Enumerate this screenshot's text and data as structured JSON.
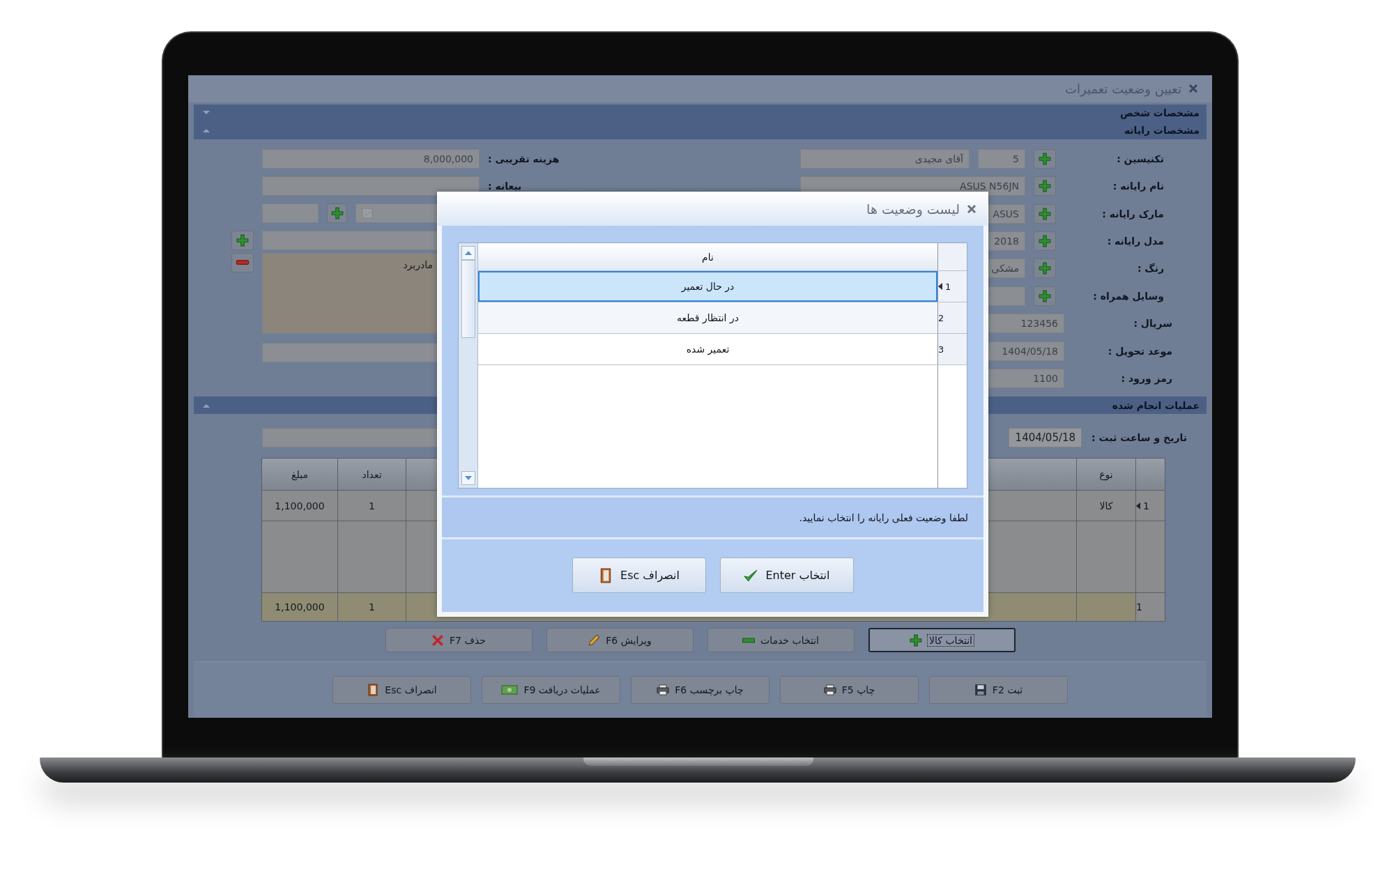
{
  "window": {
    "title": "تعیین وضعیت تعمیرات"
  },
  "sections": [
    {
      "title": "مشخصات شخص",
      "expanded": false
    },
    {
      "title": "مشخصات رایانه",
      "expanded": true
    }
  ],
  "left_fields": [
    {
      "kind": "text",
      "label": "هزینه تقریبی :",
      "value": "8,000,000"
    },
    {
      "kind": "text",
      "label": "بیعانه :"
    },
    {
      "kind": "combo-row"
    },
    {
      "kind": "add-row"
    },
    {
      "kind": "notes",
      "value": "مادربرد"
    },
    {
      "kind": "text"
    }
  ],
  "right_fields": [
    {
      "kind": "text",
      "label": "تکنیسین :",
      "code": "5",
      "value": "آقای مجیدی",
      "add_button": true
    },
    {
      "kind": "text",
      "label": "نام رایانه :",
      "value": "ASUS N56JN",
      "add_button": true
    },
    {
      "kind": "text",
      "label": "مارک رایانه :",
      "value": "ASUS",
      "add_button": true
    },
    {
      "kind": "text",
      "label": "مدل رایانه :",
      "value": "2018",
      "add_button": true
    },
    {
      "kind": "text",
      "label": "رنگ :",
      "value": "مشکی",
      "add_button": true
    },
    {
      "kind": "dropdown",
      "label": "وسایل همراه :",
      "add_button": true
    },
    {
      "kind": "text",
      "label": "سریال :",
      "value": "123456",
      "add_button": false
    },
    {
      "kind": "text",
      "label": "موعد تحویل :",
      "value": "1404/05/18",
      "add_button": false
    },
    {
      "kind": "text",
      "label": "رمز ورود :",
      "value": "1100",
      "add_button": false
    }
  ],
  "operations": {
    "title": "عملیات انجام شده",
    "expanded": true,
    "date_label": "تاریخ و ساعت ثبت :",
    "date_value": "1404/05/18"
  },
  "grid": {
    "columns": [
      "نوع",
      "تعداد",
      "مبلغ"
    ],
    "rows": [
      {
        "index": "1",
        "type": "کالا",
        "count": "1",
        "amount": "1,100,000",
        "selected": true
      }
    ],
    "footer": {
      "index": "1",
      "count": "1",
      "amount": "1,100,000"
    }
  },
  "item_buttons": [
    {
      "label": "انتخاب کالا",
      "focused": true
    },
    {
      "label": "انتخاب خدمات",
      "focused": false
    },
    {
      "label": "ویرایش F6",
      "focused": false
    },
    {
      "label": "حذف F7",
      "focused": false
    }
  ],
  "footer_buttons": [
    {
      "label": "ثبت F2"
    },
    {
      "label": "چاپ F5"
    },
    {
      "label": "چاپ برچسب F6"
    },
    {
      "label": "عملیات دریافت F9"
    },
    {
      "label": "انصراف Esc"
    }
  ],
  "dialog": {
    "title": "لیست وضعیت ها",
    "column": "نام",
    "items": [
      {
        "index": "1",
        "name": "در حال تعمیر",
        "selected": true
      },
      {
        "index": "2",
        "name": "در انتظار قطعه",
        "selected": false
      },
      {
        "index": "3",
        "name": "تعمیر شده",
        "selected": false
      }
    ],
    "message": "لطفا وضعیت فعلی رایانه را انتخاب نمایید.",
    "buttons": [
      {
        "label": "انتخاب Enter"
      },
      {
        "label": "انصراف Esc"
      }
    ]
  }
}
